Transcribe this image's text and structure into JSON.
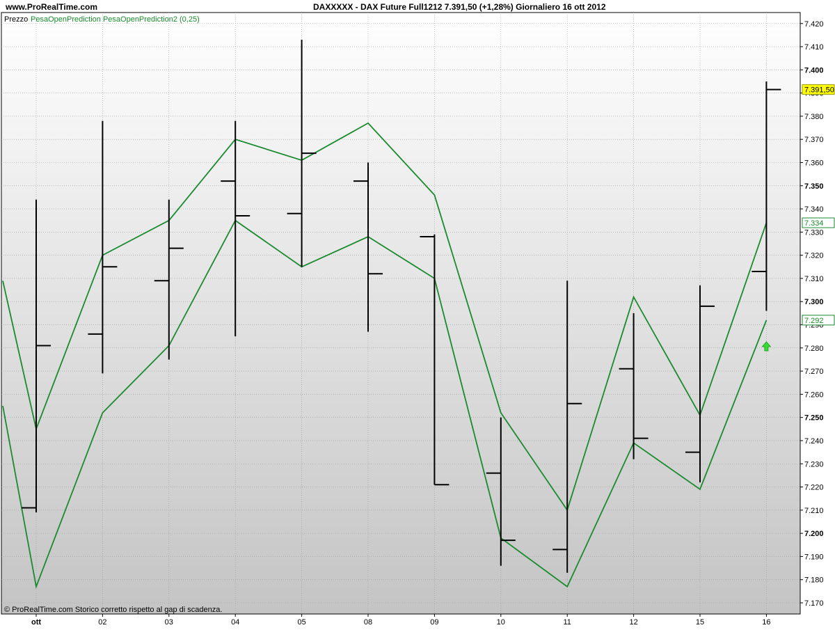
{
  "header": {
    "site": "www.ProRealTime.com",
    "title": "DAXXXXX - DAX Future Full1212   7.391,50 (+1,28%)   Giornaliero  16 ott 2012"
  },
  "legend": {
    "price_label": "Prezzo",
    "indicator_label": "PesaOpenPrediction PesaOpenPrediction2 (0,25)"
  },
  "footer": {
    "copyright": "© ProRealTime.com  Storico corretto rispetto al gap di scadenza."
  },
  "colors": {
    "bars": "#000000",
    "indicator": "#1a8a2e",
    "background_top": "#ffffff",
    "background_bottom": "#c9c9c9",
    "last_price_badge": "#ffff00",
    "arrow": "#33dd33"
  },
  "chart_data": {
    "type": "line",
    "title": "DAXXXXX - DAX Future Full1212",
    "last_price_label": "7.391,50",
    "upper_line_label": "7.334",
    "lower_line_label": "7.292",
    "x_tick_labels": [
      "ott",
      "02",
      "03",
      "04",
      "05",
      "08",
      "09",
      "10",
      "11",
      "12",
      "15",
      "16"
    ],
    "y_tick_labels": [
      "7.170",
      "7.180",
      "7.190",
      "7.200",
      "7.210",
      "7.220",
      "7.230",
      "7.240",
      "7.250",
      "7.260",
      "7.270",
      "7.280",
      "7.290",
      "7.300",
      "7.310",
      "7.320",
      "7.330",
      "7.340",
      "7.350",
      "7.360",
      "7.370",
      "7.380",
      "7.390",
      "7.400",
      "7.410",
      "7.420"
    ],
    "y_major_ticks": [
      7200,
      7250,
      7300,
      7350,
      7400
    ],
    "ylim": [
      7165,
      7425
    ],
    "ohlc": [
      {
        "date": "ott",
        "open": 7211,
        "high": 7344,
        "low": 7209,
        "close": 7281
      },
      {
        "date": "02",
        "open": 7286,
        "high": 7378,
        "low": 7269,
        "close": 7315
      },
      {
        "date": "03",
        "open": 7309,
        "high": 7344,
        "low": 7275,
        "close": 7323
      },
      {
        "date": "04",
        "open": 7352,
        "high": 7378,
        "low": 7285,
        "close": 7337
      },
      {
        "date": "05",
        "open": 7338,
        "high": 7413,
        "low": 7315,
        "close": 7364
      },
      {
        "date": "08",
        "open": 7352,
        "high": 7360,
        "low": 7287,
        "close": 7312
      },
      {
        "date": "09",
        "open": 7328,
        "high": 7329,
        "low": 7221,
        "close": 7221
      },
      {
        "date": "10",
        "open": 7226,
        "high": 7250,
        "low": 7186,
        "close": 7197
      },
      {
        "date": "11",
        "open": 7193,
        "high": 7309,
        "low": 7183,
        "close": 7256
      },
      {
        "date": "12",
        "open": 7271,
        "high": 7295,
        "low": 7232,
        "close": 7241
      },
      {
        "date": "15",
        "open": 7235,
        "high": 7307,
        "low": 7222,
        "close": 7298
      },
      {
        "date": "16",
        "open": 7313,
        "high": 7395,
        "low": 7296,
        "close": 7391.5
      }
    ],
    "series": [
      {
        "values": [
          7309,
          7245,
          7320,
          7335,
          7370,
          7361,
          7377,
          7346,
          7252,
          7210,
          7302,
          7251,
          7334
        ]
      },
      {
        "values": [
          7255,
          7177,
          7252,
          7281,
          7335,
          7315,
          7328,
          7310,
          7198,
          7177,
          7239,
          7219,
          7292
        ]
      }
    ],
    "series_x": [
      "",
      "ott",
      "02",
      "03",
      "04",
      "05",
      "08",
      "09",
      "10",
      "11",
      "12",
      "15",
      "16"
    ]
  }
}
